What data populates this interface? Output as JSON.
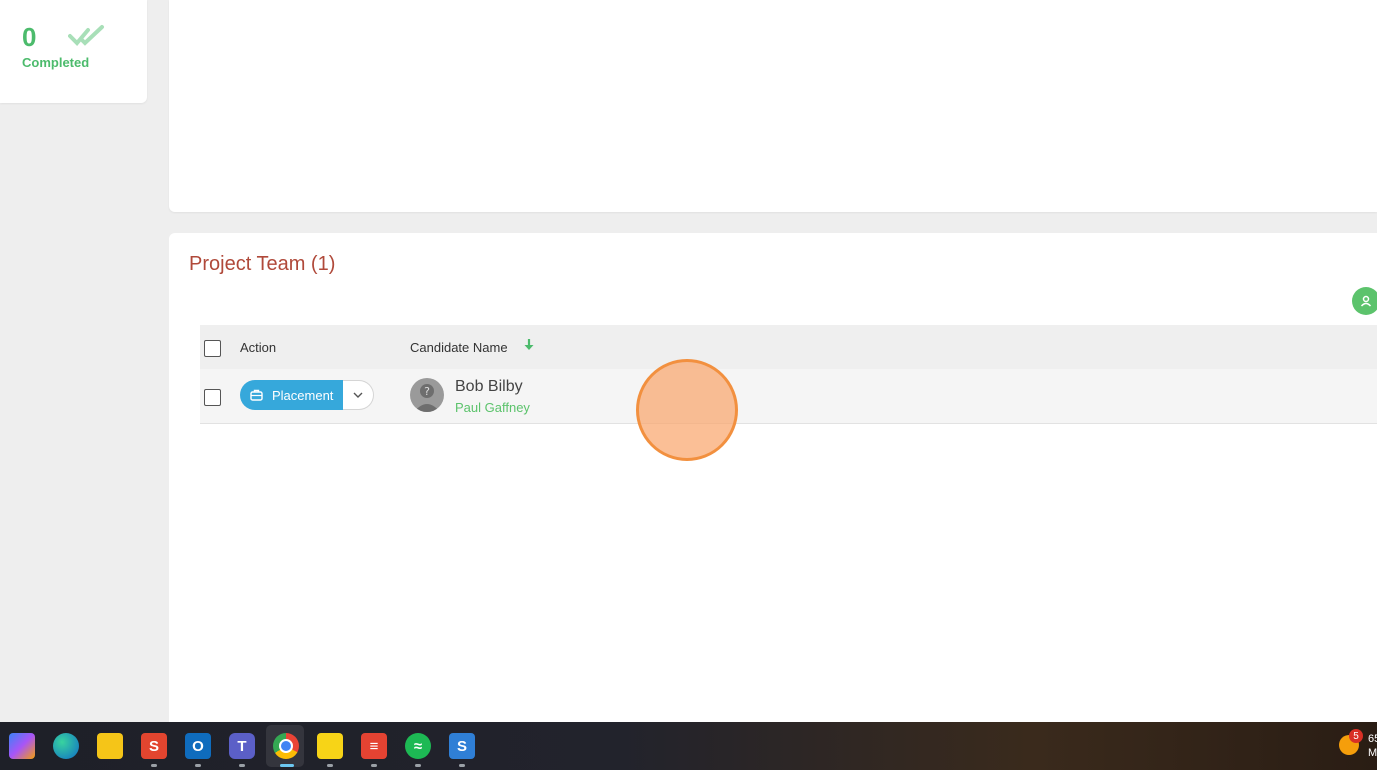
{
  "stats": {
    "completed_count": "0",
    "completed_label": "Completed"
  },
  "team": {
    "title": "Project Team (1)",
    "table": {
      "headers": {
        "action": "Action",
        "candidate_name": "Candidate Name"
      },
      "rows": [
        {
          "action_label": "Placement",
          "candidate_name": "Bob Bilby",
          "candidate_sub": "Paul Gaffney"
        }
      ]
    }
  },
  "taskbar": {
    "apps": [
      "copilot-icon",
      "edge-icon",
      "file-explorer-icon",
      "s-app-icon",
      "outlook-icon",
      "teams-icon",
      "chrome-icon",
      "sticky-notes-icon",
      "todoist-icon",
      "spotify-icon",
      "s-app-2-icon"
    ],
    "weather_badge": "5",
    "tray_text_line1": "65",
    "tray_text_line2": "M"
  },
  "colors": {
    "accent_green": "#4cbb6c",
    "title_red": "#b0493a",
    "button_blue": "#36a8db"
  }
}
